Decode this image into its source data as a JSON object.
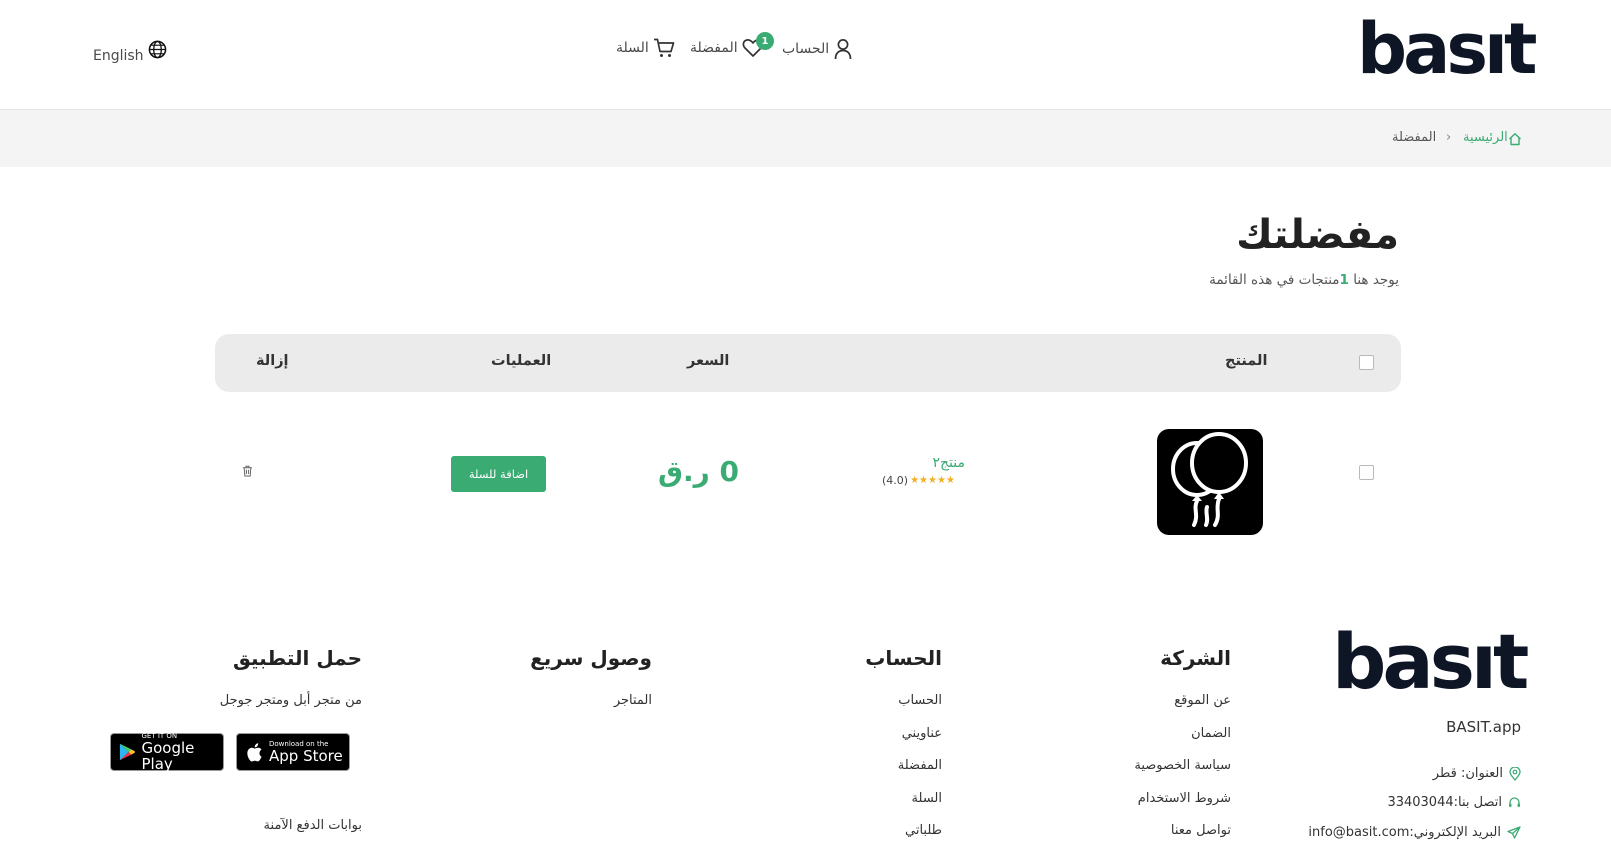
{
  "header": {
    "logo": "basıt",
    "language": "English",
    "account": "الحساب",
    "favorites": "المفضلة",
    "favorites_count": "1",
    "cart": "السلة"
  },
  "breadcrumb": {
    "home": "الرئيسية",
    "separator": "›",
    "current": "المفضلة"
  },
  "page": {
    "title": "مفضلتك",
    "subtitle_prefix": "يوجد هنا",
    "subtitle_count": "1",
    "subtitle_suffix": "منتجات في هذه القائمة"
  },
  "table": {
    "headers": {
      "product": "المنتج",
      "price": "السعر",
      "actions": "العمليات",
      "remove": "إزالة"
    },
    "rows": [
      {
        "name": "منتج٢",
        "rating": "(4.0)",
        "stars": "★★★★★",
        "price": "0 ر.ق",
        "add_to_cart": "اضافة للسلة"
      }
    ]
  },
  "footer": {
    "logo": "basıt",
    "site": "BASIT.app",
    "address": "العنوان: قطر",
    "phone": "اتصل بنا:33403044",
    "email": "البريد الإلكتروني:info@basit.com",
    "company": {
      "heading": "الشركة",
      "links": [
        "عن الموقع",
        "الضمان",
        "سياسة الخصوصية",
        "شروط الاستخدام",
        "تواصل معنا"
      ]
    },
    "account": {
      "heading": "الحساب",
      "links": [
        "الحساب",
        "عناويني",
        "المفضلة",
        "السلة",
        "طلباتي"
      ]
    },
    "quick": {
      "heading": "وصول سريع",
      "links": [
        "المتاجر"
      ]
    },
    "app": {
      "heading": "حمل التطبيق",
      "text": "من متجر أبل ومتجر جوجل",
      "payment": "بوابات الدفع الآمنة",
      "appstore_small": "Download on the",
      "appstore_big": "App Store",
      "googleplay_small": "GET IT ON",
      "googleplay_big": "Google Play"
    }
  },
  "colors": {
    "accent": "#3aab73",
    "dark": "#0e1625"
  }
}
